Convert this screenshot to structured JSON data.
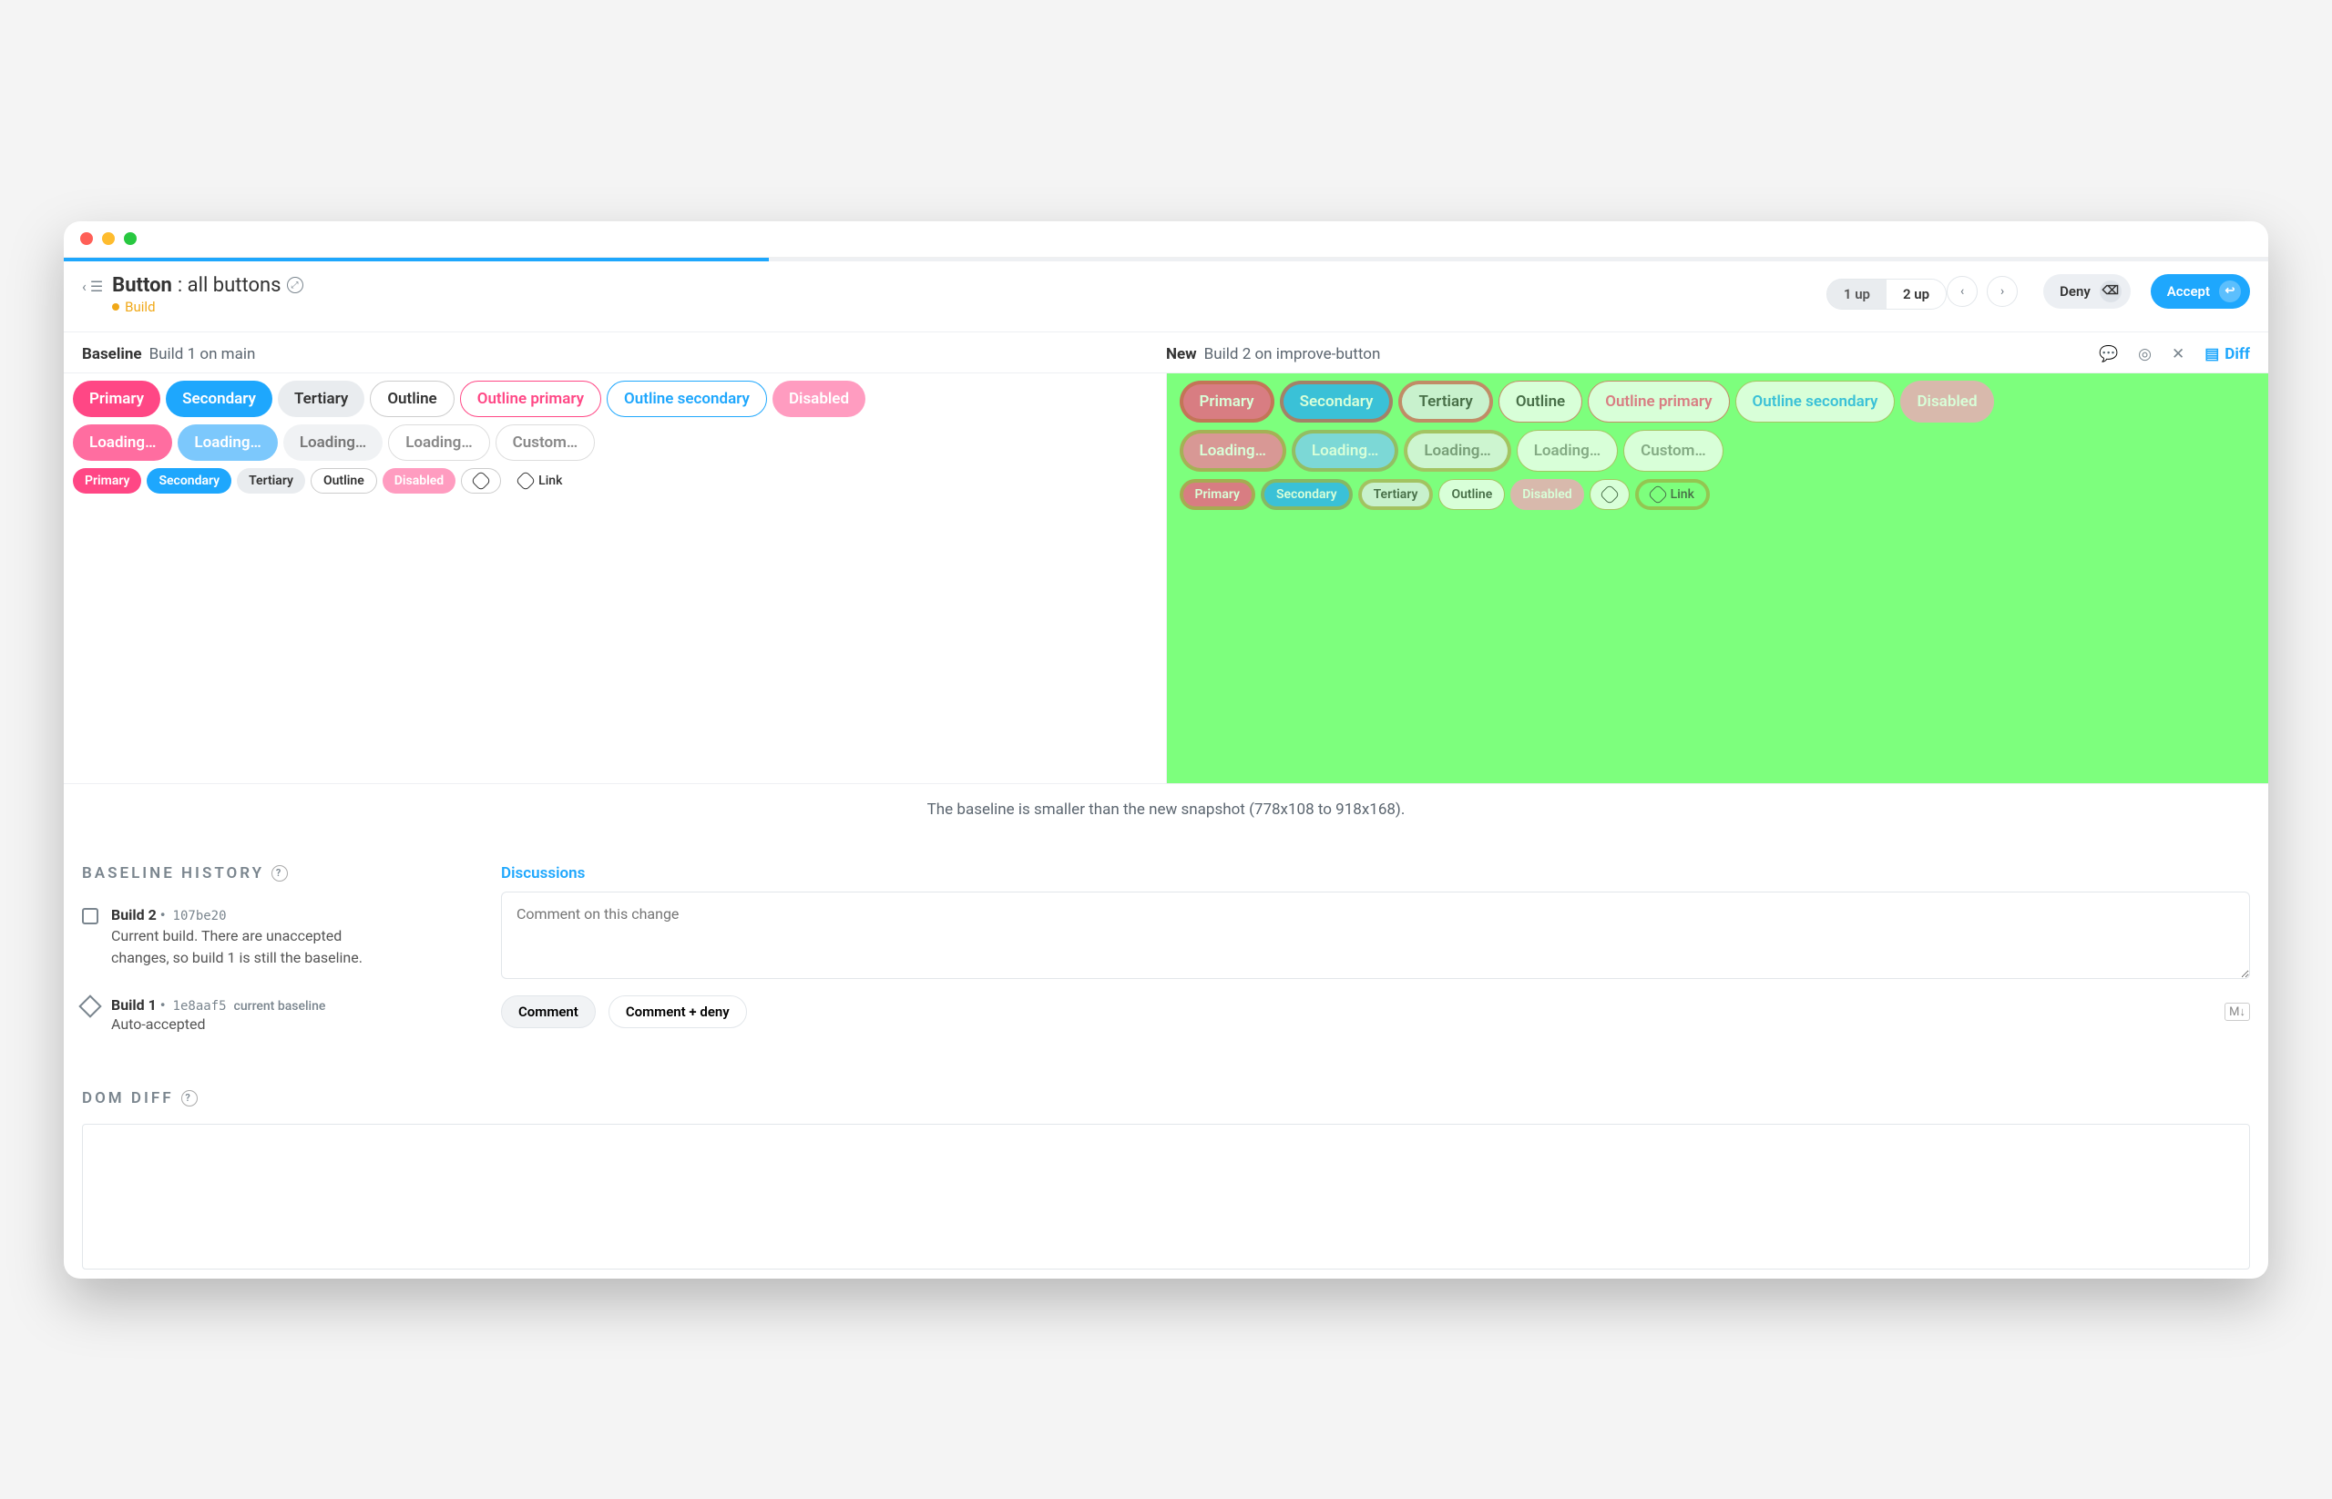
{
  "window": {
    "progress_pct": 32
  },
  "header": {
    "title_strong": "Button",
    "title_rest": ": all buttons",
    "sub_label": "Build",
    "up_toggle": {
      "left": "1 up",
      "right": "2 up",
      "active": "right"
    },
    "deny_label": "Deny",
    "accept_label": "Accept"
  },
  "columns": {
    "baseline": {
      "title": "Baseline",
      "sub": "Build 1 on main"
    },
    "new": {
      "title": "New",
      "sub": "Build 2 on improve-button"
    },
    "diff_label": "Diff"
  },
  "baseline_snapshot": {
    "row1": [
      "Primary",
      "Secondary",
      "Tertiary",
      "Outline",
      "Outline primary",
      "Outline secondary",
      "Disabled"
    ],
    "row2": [
      "Loading…",
      "Loading…",
      "Loading…",
      "Loading…",
      "Custom…"
    ],
    "row3": [
      "Primary",
      "Secondary",
      "Tertiary",
      "Outline",
      "Disabled",
      "",
      "Link"
    ]
  },
  "new_snapshot": {
    "row1": [
      "Primary",
      "Secondary",
      "Tertiary",
      "Outline",
      "Outline primary",
      "Outline secondary",
      "Disabled"
    ],
    "row2": [
      "Loading…",
      "Loading…",
      "Loading…",
      "Loading…",
      "Custom…"
    ],
    "row3": [
      "Primary",
      "Secondary",
      "Tertiary",
      "Outline",
      "Disabled",
      "",
      "Link"
    ]
  },
  "size_note": "The baseline is smaller than the new snapshot (778x108 to 918x168).",
  "history": {
    "title": "BASELINE HISTORY",
    "builds": [
      {
        "name": "Build 2",
        "hash": "107be20",
        "tag": "",
        "desc": "Current build. There are unaccepted changes, so build 1 is still the baseline."
      },
      {
        "name": "Build 1",
        "hash": "1e8aaf5",
        "tag": "current baseline",
        "desc": "Auto-accepted"
      }
    ]
  },
  "discussion": {
    "tab": "Discussions",
    "placeholder": "Comment on this change",
    "comment_btn": "Comment",
    "comment_deny_btn": "Comment + deny",
    "md_badge": "M↓"
  },
  "domdiff": {
    "title": "DOM DIFF"
  }
}
